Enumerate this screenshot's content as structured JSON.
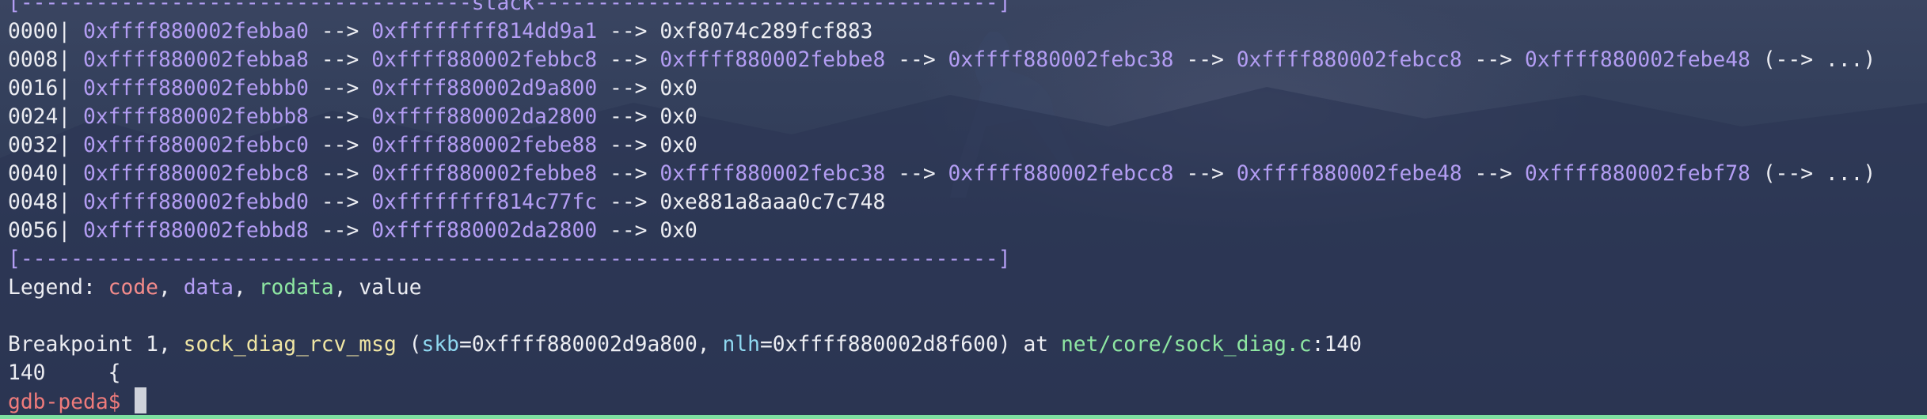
{
  "colors": {
    "address": "#b39df3",
    "code": "#f38b8b",
    "rodata": "#8ee6a2",
    "function": "#f0e6a4",
    "param": "#8fd8f0",
    "prompt": "#ee7b7b",
    "statusbar": "#7ee0a0"
  },
  "stack": {
    "header": "[------------------------------------stack-------------------------------------]",
    "footer": "[------------------------------------------------------------------------------]",
    "rows": [
      {
        "offset": "0000|",
        "a1": "0xffff880002febba0",
        "a2": "0xffffffff814dd9a1",
        "tail": "0xf8074c289fcf883"
      },
      {
        "offset": "0008|",
        "a1": "0xffff880002febba8",
        "a2": "0xffff880002febbc8",
        "a3": "0xffff880002febbe8",
        "a4": "0xffff880002febc38",
        "a5": "0xffff880002febcc8",
        "a6": "0xffff880002febe48",
        "ellipsis": "(--> ...)"
      },
      {
        "offset": "0016|",
        "a1": "0xffff880002febbb0",
        "a2": "0xffff880002d9a800",
        "tail": "0x0"
      },
      {
        "offset": "0024|",
        "a1": "0xffff880002febbb8",
        "a2": "0xffff880002da2800",
        "tail": "0x0"
      },
      {
        "offset": "0032|",
        "a1": "0xffff880002febbc0",
        "a2": "0xffff880002febe88",
        "tail": "0x0"
      },
      {
        "offset": "0040|",
        "a1": "0xffff880002febbc8",
        "a2": "0xffff880002febbe8",
        "a3": "0xffff880002febc38",
        "a4": "0xffff880002febcc8",
        "a5": "0xffff880002febe48",
        "a6": "0xffff880002febf78",
        "ellipsis": "(--> ...)"
      },
      {
        "offset": "0048|",
        "a1": "0xffff880002febbd0",
        "a2": "0xffffffff814c77fc",
        "tail": "0xe881a8aaa0c7c748"
      },
      {
        "offset": "0056|",
        "a1": "0xffff880002febbd8",
        "a2": "0xffff880002da2800",
        "tail": "0x0"
      }
    ]
  },
  "arrow": "-->",
  "legend": {
    "prefix": "Legend: ",
    "code": "code",
    "data": "data",
    "rodata": "rodata",
    "value": "value"
  },
  "breakpoint": {
    "prefix": "Breakpoint 1, ",
    "function": "sock_diag_rcv_msg",
    "open": " (",
    "param1": "skb",
    "value1": "=0xffff880002d9a800, ",
    "param2": "nlh",
    "value2": "=0xffff880002d8f600",
    "close": ") at ",
    "file": "net/core/sock_diag.c",
    "line": ":140"
  },
  "source_line": {
    "number": "140",
    "code": "     {"
  },
  "prompt": "gdb-peda$ "
}
